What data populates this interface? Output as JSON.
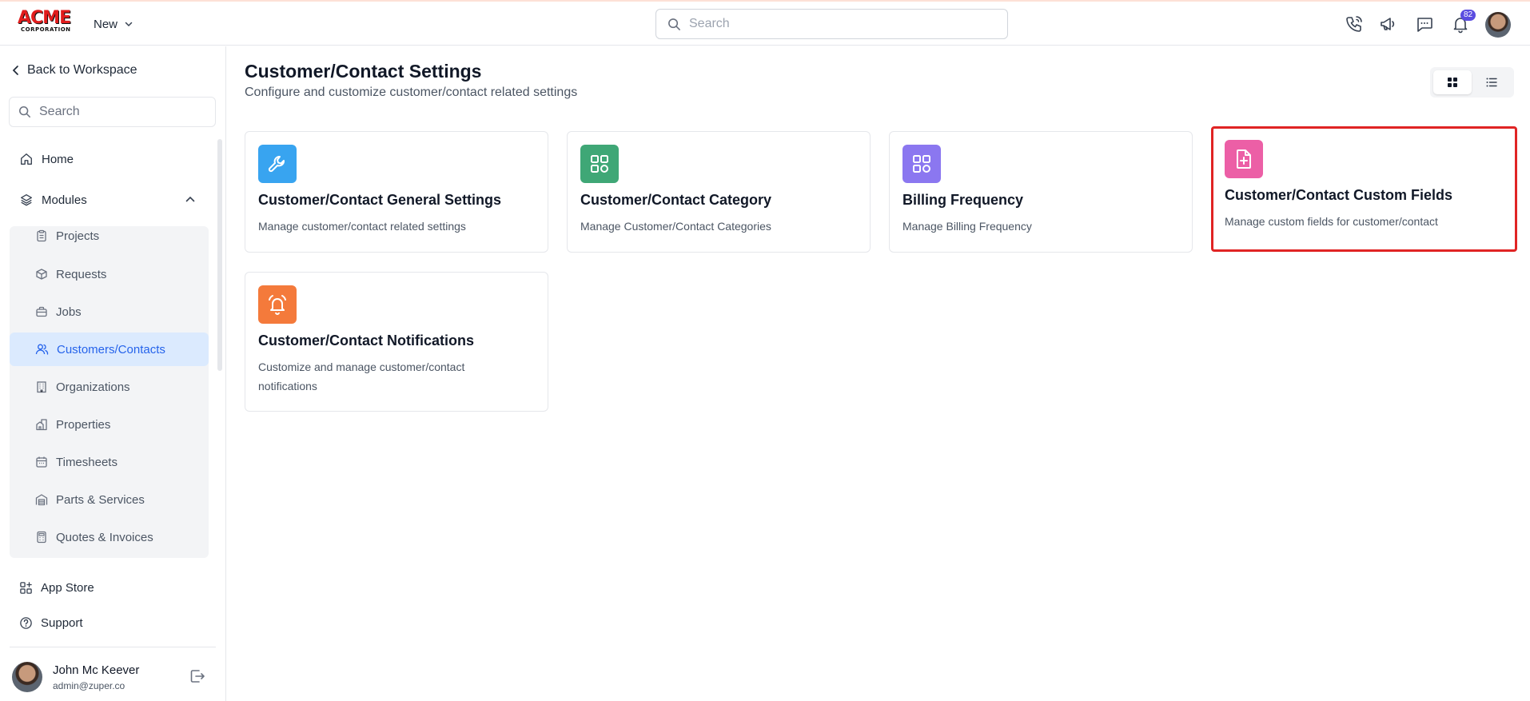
{
  "header": {
    "logo_main": "ACME",
    "logo_sub": "CORPORATION",
    "new_label": "New",
    "search_placeholder": "Search",
    "notification_count": "82",
    "icons": [
      "phone-icon",
      "megaphone-icon",
      "chat-icon",
      "bell-icon"
    ]
  },
  "sidebar": {
    "back_label": "Back to Workspace",
    "search_placeholder": "Search",
    "home_label": "Home",
    "modules_label": "Modules",
    "modules": [
      {
        "label": "Projects",
        "icon": "clipboard-icon",
        "active": false
      },
      {
        "label": "Requests",
        "icon": "box-icon",
        "active": false
      },
      {
        "label": "Jobs",
        "icon": "briefcase-icon",
        "active": false
      },
      {
        "label": "Customers/Contacts",
        "icon": "users-icon",
        "active": true
      },
      {
        "label": "Organizations",
        "icon": "building-icon",
        "active": false
      },
      {
        "label": "Properties",
        "icon": "properties-icon",
        "active": false
      },
      {
        "label": "Timesheets",
        "icon": "calendar-icon",
        "active": false
      },
      {
        "label": "Parts & Services",
        "icon": "warehouse-icon",
        "active": false
      },
      {
        "label": "Quotes & Invoices",
        "icon": "calculator-icon",
        "active": false
      }
    ],
    "app_store_label": "App Store",
    "support_label": "Support",
    "user": {
      "name": "John Mc Keever",
      "email": "admin@zuper.co"
    }
  },
  "main": {
    "title": "Customer/Contact Settings",
    "subtitle": "Configure and customize customer/contact related settings",
    "cards": [
      {
        "title": "Customer/Contact General Settings",
        "description": "Manage customer/contact related settings",
        "icon": "wrench-icon",
        "color": "#38a4f0"
      },
      {
        "title": "Customer/Contact Category",
        "description": "Manage Customer/Contact Categories",
        "icon": "grid-icon",
        "color": "#3fa776"
      },
      {
        "title": "Billing Frequency",
        "description": "Manage Billing Frequency",
        "icon": "apps-icon",
        "color": "#8b77f0"
      },
      {
        "title": "Customer/Contact Custom Fields",
        "description": "Manage custom fields for customer/contact",
        "icon": "file-plus-icon",
        "color": "#ec5fa6"
      },
      {
        "title": "Customer/Contact Notifications",
        "description": "Customize and manage customer/contact notifications",
        "icon": "alarm-icon",
        "color": "#f47a3b"
      }
    ]
  }
}
